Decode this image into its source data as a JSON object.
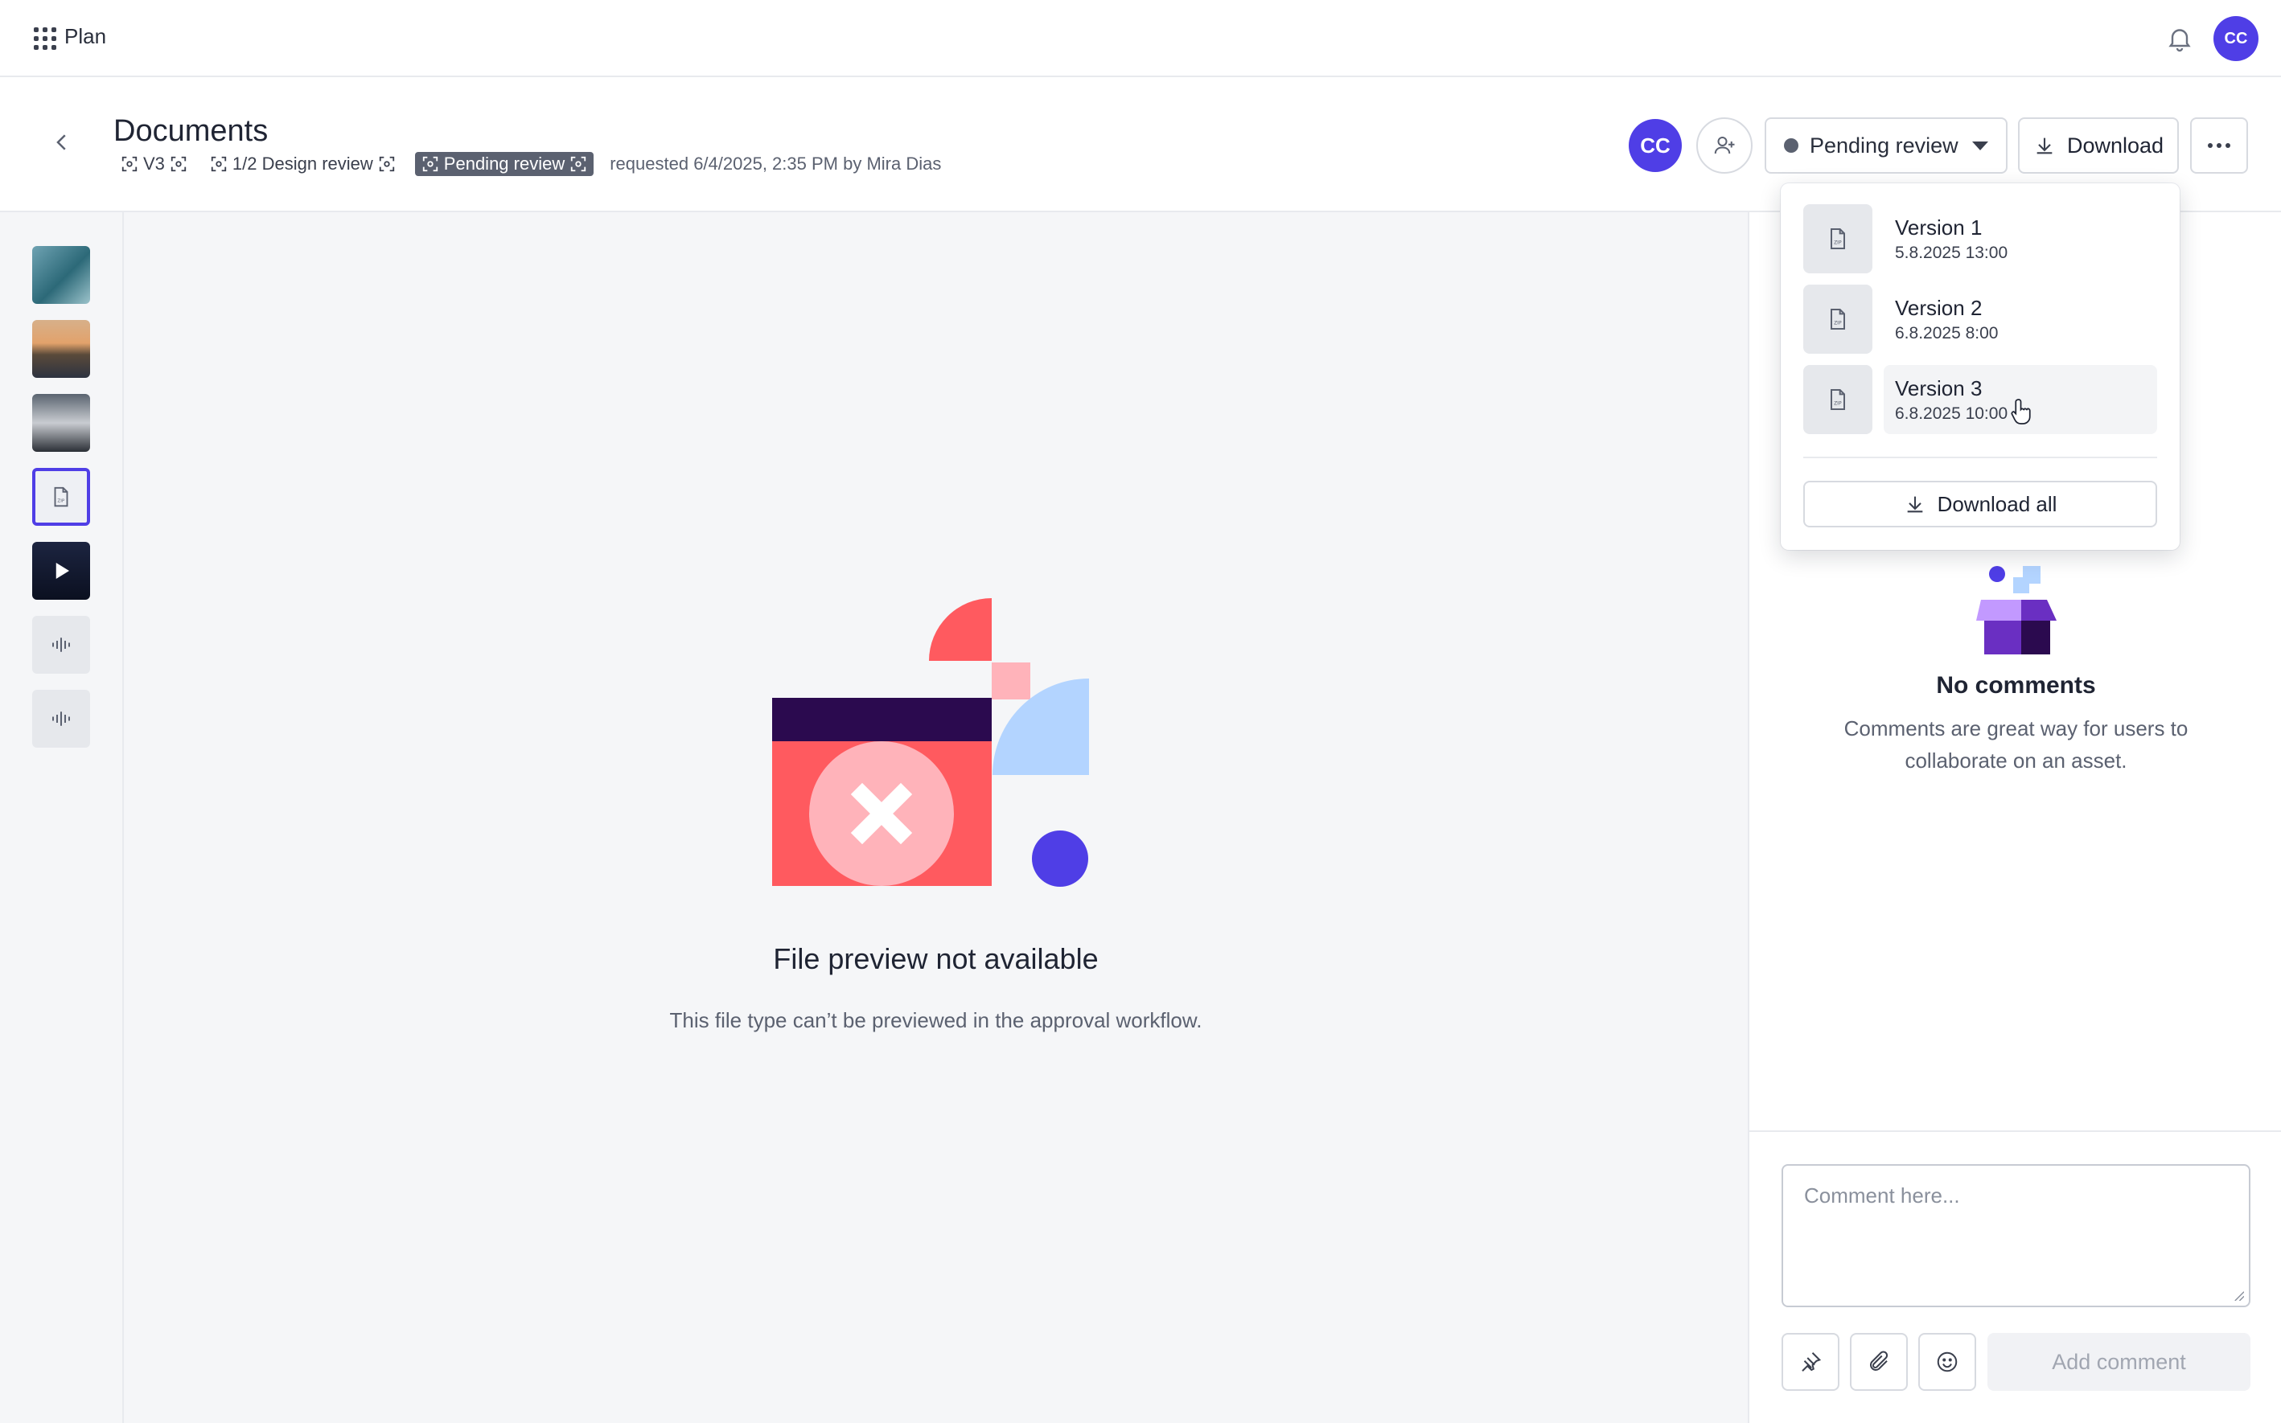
{
  "app": {
    "name": "Plan"
  },
  "user": {
    "initials": "CC"
  },
  "header": {
    "title": "Documents",
    "version_chip": "V3",
    "review_chip": "1/2 Design review",
    "status_chip": "Pending review",
    "requested": "requested 6/4/2025, 2:35 PM by Mira Dias",
    "assignee_initials": "CC",
    "status_label": "Pending review",
    "download_label": "Download"
  },
  "versions_menu": {
    "items": [
      {
        "name": "Version 1",
        "date": "5.8.2025 13:00"
      },
      {
        "name": "Version 2",
        "date": "6.8.2025 8:00"
      },
      {
        "name": "Version 3",
        "date": "6.8.2025 10:00"
      }
    ],
    "download_all_label": "Download all"
  },
  "preview": {
    "title": "File preview not available",
    "subtitle": "This file type can’t be previewed in the approval workflow."
  },
  "comments": {
    "empty_title": "No comments",
    "empty_text": "Comments are great way for users to collaborate on an asset.",
    "placeholder": "Comment here...",
    "add_label": "Add comment"
  },
  "colors": {
    "accent": "#4f3ee6",
    "status_dot": "#5b6170",
    "illustration_red": "#ff5a5f",
    "illustration_pink": "#ffb3ba",
    "illustration_blue": "#b3d4ff",
    "illustration_dark": "#2b0a4f"
  },
  "icons": {
    "apps": "apps-grid-icon",
    "bell": "bell-icon",
    "back": "chevron-left-icon",
    "add_user": "user-plus-icon",
    "download": "download-icon",
    "more": "more-horizontal-icon",
    "zip": "zip-file-icon",
    "pin": "pin-icon",
    "attach": "paperclip-icon",
    "emoji": "smiley-icon"
  }
}
